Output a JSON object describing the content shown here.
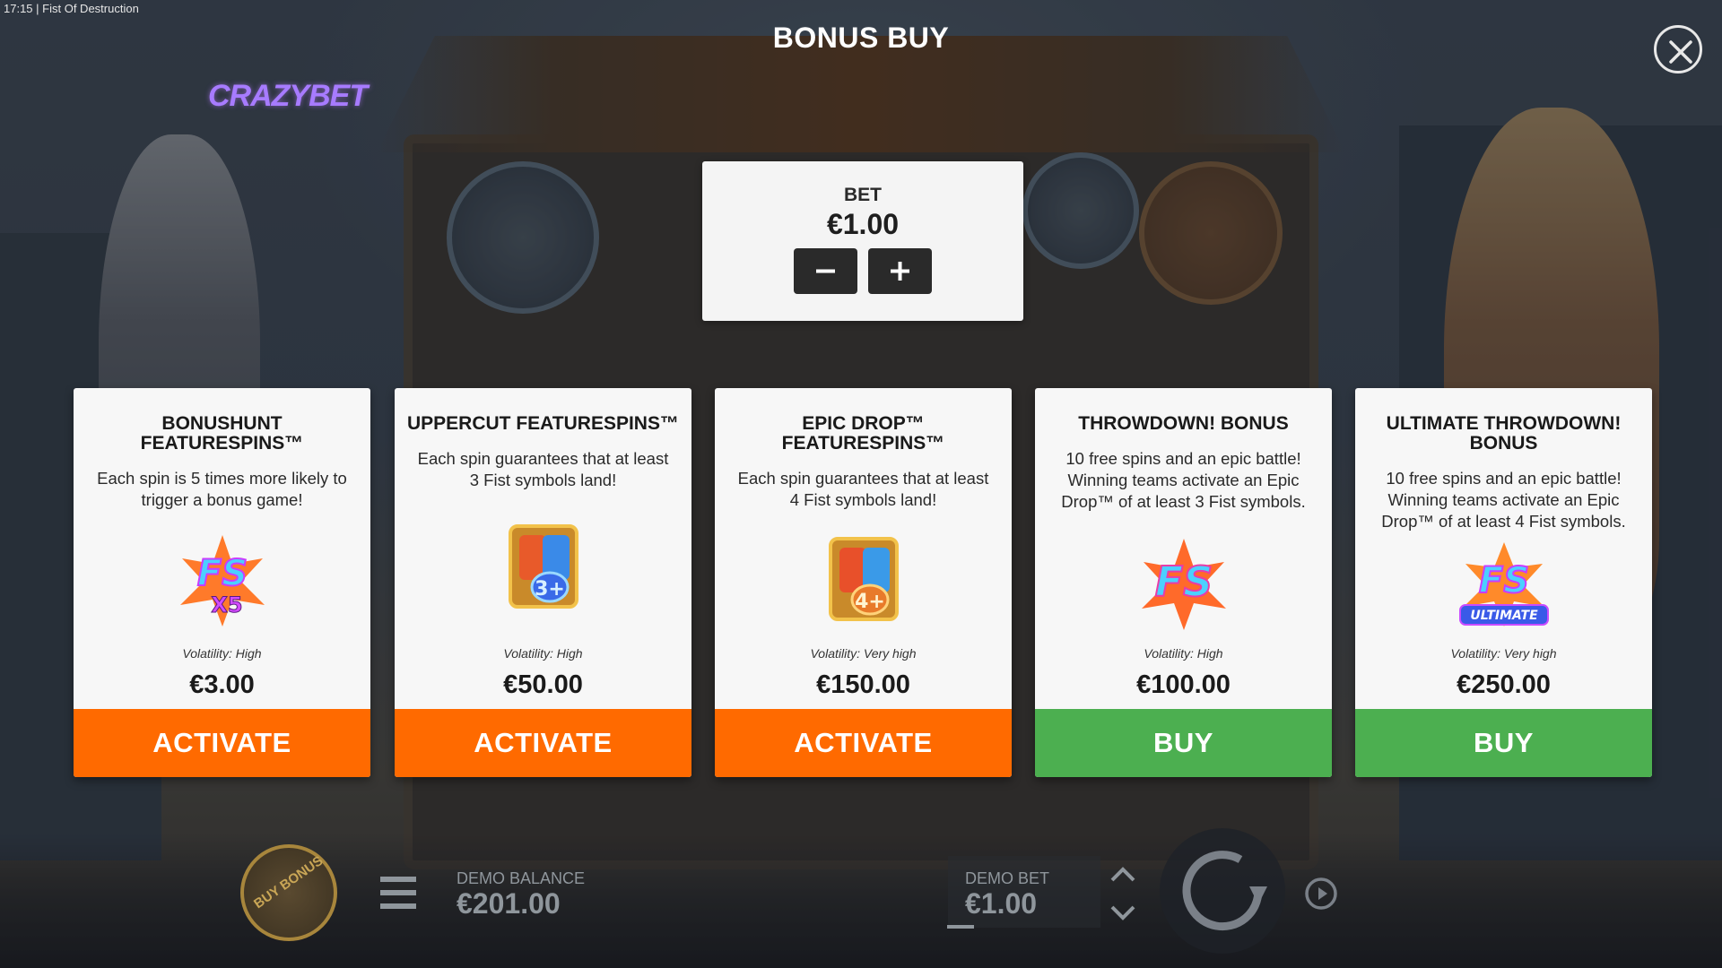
{
  "status": {
    "time": "17:15",
    "game_name": "Fist Of Destruction"
  },
  "header": {
    "title": "BONUS BUY",
    "logo_text": "CRAZYBET"
  },
  "bet_panel": {
    "label": "BET",
    "value": "€1.00"
  },
  "cards": [
    {
      "title": "BONUSHUNT FEATURESPINS™",
      "description": "Each spin is 5 times more likely to trigger a bonus game!",
      "icon": "fs-x5-icon",
      "icon_caption": "X5",
      "volatility": "Volatility: High",
      "price": "€3.00",
      "button": "ACTIVATE",
      "button_color": "#ff6a00"
    },
    {
      "title": "UPPERCUT FEATURESPINS™",
      "description": "Each spin guarantees that at least 3 Fist symbols land!",
      "icon": "fist-3plus-icon",
      "icon_caption": "3+",
      "volatility": "Volatility: High",
      "price": "€50.00",
      "button": "ACTIVATE",
      "button_color": "#ff6a00"
    },
    {
      "title": "EPIC DROP™ FEATURESPINS™",
      "description": "Each spin guarantees that at least 4 Fist symbols land!",
      "icon": "fist-4plus-icon",
      "icon_caption": "4+",
      "volatility": "Volatility: Very high",
      "price": "€150.00",
      "button": "ACTIVATE",
      "button_color": "#ff6a00"
    },
    {
      "title": "THROWDOWN! BONUS",
      "description": "10 free spins and an epic battle! Winning teams activate an Epic Drop™ of at least 3 Fist symbols.",
      "icon": "fs-icon",
      "icon_caption": "",
      "volatility": "Volatility: High",
      "price": "€100.00",
      "button": "BUY",
      "button_color": "#4caf50"
    },
    {
      "title": "ULTIMATE THROWDOWN! BONUS",
      "description": "10 free spins and an epic battle! Winning teams activate an Epic Drop™ of at least 4 Fist symbols.",
      "icon": "fs-ultimate-icon",
      "icon_caption": "ULTIMATE",
      "volatility": "Volatility: Very high",
      "price": "€250.00",
      "button": "BUY",
      "button_color": "#4caf50"
    }
  ],
  "bottom_bar": {
    "buy_bonus_label": "BUY BONUS",
    "demo_balance_label": "DEMO BALANCE",
    "demo_balance_value": "€201.00",
    "demo_bet_label": "DEMO BET",
    "demo_bet_value": "€1.00"
  },
  "colors": {
    "activate": "#ff6a00",
    "buy": "#4caf50",
    "card_bg": "#f7f7f7"
  }
}
